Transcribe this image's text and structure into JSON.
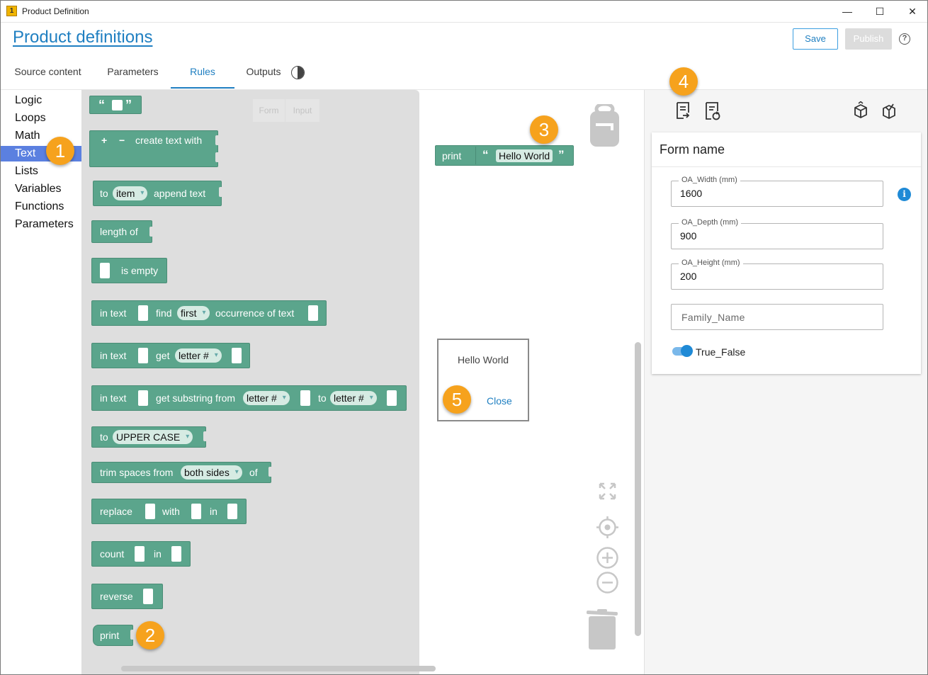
{
  "window": {
    "title": "Product Definition",
    "minimize": "—",
    "maximize": "☐",
    "close": "✕",
    "app_icon": "1"
  },
  "header": {
    "title": "Product definitions",
    "save_label": "Save",
    "publish_label": "Publish",
    "help": "?"
  },
  "tabs": [
    {
      "label": "Source content"
    },
    {
      "label": "Parameters"
    },
    {
      "label": "Rules",
      "active": true
    },
    {
      "label": "Outputs"
    }
  ],
  "categories": [
    "Logic",
    "Loops",
    "Math",
    "Text",
    "Lists",
    "Variables",
    "Functions",
    "Parameters"
  ],
  "selected_category": "Text",
  "flyout": {
    "ghost_tabs": [
      "Form",
      "Input"
    ],
    "blocks": {
      "quote_open": "“",
      "quote_close": "”",
      "create_plus": "+",
      "create_minus": "−",
      "create_text": "create text with",
      "append_to": "to",
      "append_var": "item",
      "append_text": "append text",
      "length_of": "length of",
      "is_empty": "is empty",
      "find_in_text": "in text",
      "find_find": "find",
      "find_mode": "first",
      "find_occ": "occurrence of text",
      "get_in_text": "in text",
      "get_get": "get",
      "get_mode": "letter #",
      "sub_in_text": "in text",
      "sub_get": "get substring from",
      "sub_from": "letter #",
      "sub_to": "to",
      "sub_to_mode": "letter #",
      "case_to": "to",
      "case_mode": "UPPER CASE",
      "trim": "trim spaces from",
      "trim_mode": "both sides",
      "trim_of": "of",
      "replace": "replace",
      "replace_with": "with",
      "replace_in": "in",
      "count": "count",
      "count_in": "in",
      "reverse": "reverse",
      "print": "print"
    }
  },
  "workspace": {
    "print_label": "print",
    "string_value": "Hello World",
    "dialog_message": "Hello World",
    "dialog_close": "Close"
  },
  "badges": [
    "1",
    "2",
    "3",
    "4",
    "5"
  ],
  "form": {
    "title": "Form name",
    "fields": [
      {
        "label": "OA_Width (mm)",
        "value": "1600"
      },
      {
        "label": "OA_Depth (mm)",
        "value": "900"
      },
      {
        "label": "OA_Height (mm)",
        "value": "200"
      }
    ],
    "family_placeholder": "Family_Name",
    "toggle_label": "True_False",
    "toggle_on": true,
    "info": "i"
  },
  "colors": {
    "accent": "#1f7fc1",
    "block": "#5ba58c",
    "badge": "#f6a21d",
    "selected_category": "#5b80e0"
  },
  "icons": [
    "search-rule-icon",
    "refresh-rule-icon",
    "cube-icon",
    "cube-check-icon",
    "backpack-icon",
    "trash-icon",
    "fullscreen-icon",
    "recenter-icon",
    "zoom-in-icon",
    "zoom-out-icon",
    "contrast-icon",
    "help-icon",
    "info-icon"
  ]
}
